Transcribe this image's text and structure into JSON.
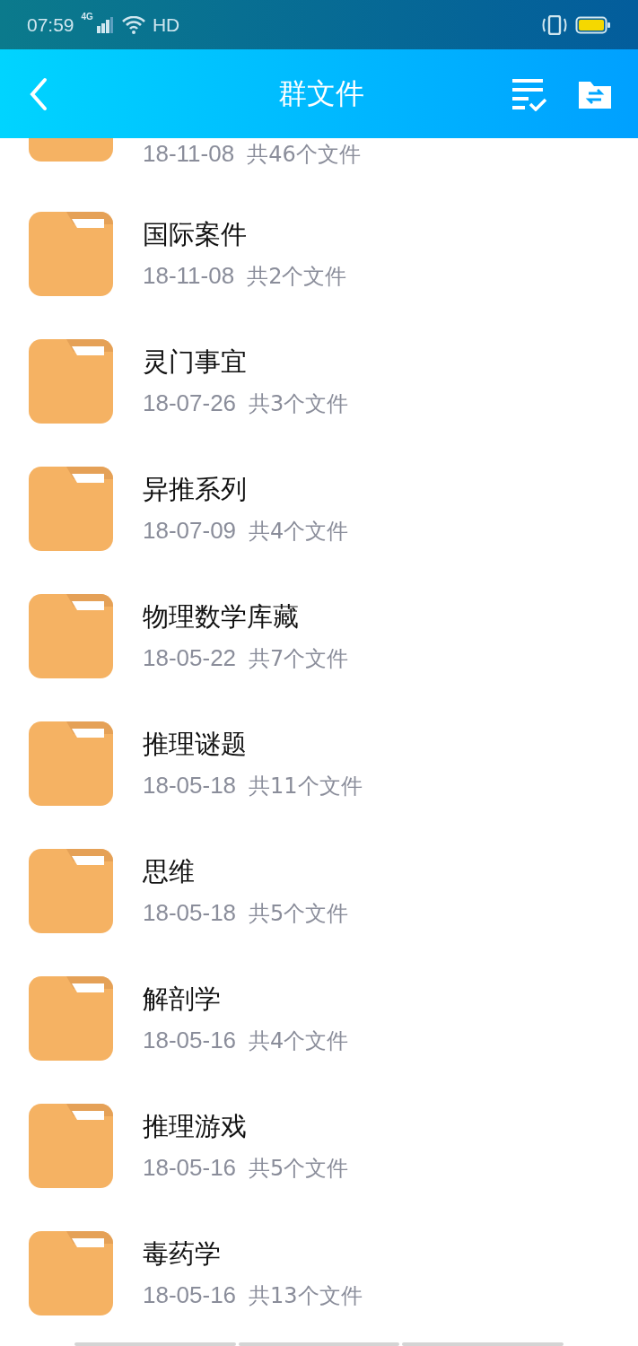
{
  "status_bar": {
    "time": "07:59",
    "network": "4G",
    "hd": "HD"
  },
  "header": {
    "title": "群文件"
  },
  "folders": [
    {
      "date": "18-11-08",
      "count": "共46个文件",
      "partial": true
    },
    {
      "name": "国际案件",
      "date": "18-11-08",
      "count": "共2个文件",
      "partial": false
    },
    {
      "name": "灵门事宜",
      "date": "18-07-26",
      "count": "共3个文件",
      "partial": false
    },
    {
      "name": "异推系列",
      "date": "18-07-09",
      "count": "共4个文件",
      "partial": false
    },
    {
      "name": "物理数学库藏",
      "date": "18-05-22",
      "count": "共7个文件",
      "partial": false
    },
    {
      "name": "推理谜题",
      "date": "18-05-18",
      "count": "共11个文件",
      "partial": false
    },
    {
      "name": "思维",
      "date": "18-05-18",
      "count": "共5个文件",
      "partial": false
    },
    {
      "name": "解剖学",
      "date": "18-05-16",
      "count": "共4个文件",
      "partial": false
    },
    {
      "name": "推理游戏",
      "date": "18-05-16",
      "count": "共5个文件",
      "partial": false
    },
    {
      "name": "毒药学",
      "date": "18-05-16",
      "count": "共13个文件",
      "partial": false
    }
  ]
}
